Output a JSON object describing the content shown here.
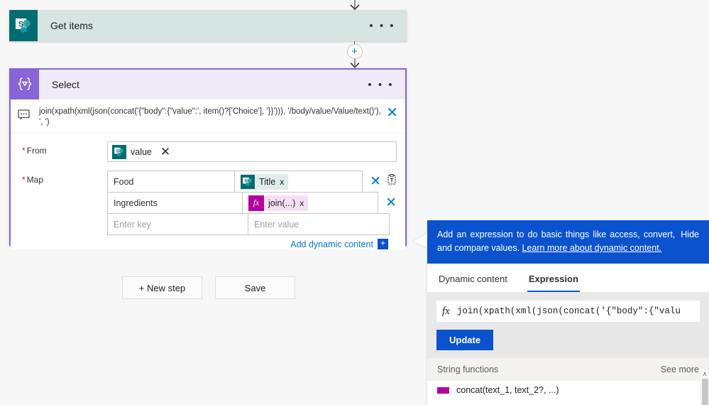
{
  "flow": {
    "get_items": {
      "title": "Get items",
      "icon": "sharepoint-icon",
      "menu": "• • •",
      "header_color": "#d6e4e2",
      "icon_color": "#036c70"
    },
    "add_step_plus": "+",
    "select": {
      "title": "Select",
      "icon": "select-braces-icon",
      "menu": "• • •",
      "header_color": "#eeeaf8",
      "icon_color": "#8764d8",
      "border_color": "#8764d8",
      "expression_summary": "join(xpath(xml(json(concat('{\"body\":{\"value\":', item()?['Choice'], '}}'))), '/body/value/Value/text()'), ', ')",
      "from": {
        "label": "From",
        "required": true,
        "token": {
          "label": "value",
          "icon": "sharepoint-icon"
        }
      },
      "map": {
        "label": "Map",
        "required": true,
        "rows": [
          {
            "key": "Food",
            "value": "Title",
            "value_kind": "sharepoint",
            "has_clipboard": true
          },
          {
            "key": "Ingredients",
            "value": "join(...)",
            "value_kind": "expression",
            "has_clipboard": false
          }
        ],
        "empty_row": {
          "key_placeholder": "Enter key",
          "value_placeholder": "Enter value"
        }
      },
      "add_dynamic_content": "Add dynamic content",
      "add_dynamic_plus": "+"
    }
  },
  "footer_buttons": [
    {
      "label": "+ New step",
      "name": "new-step-button"
    },
    {
      "label": "Save",
      "name": "save-button"
    }
  ],
  "expression_panel": {
    "banner": {
      "text_before_link": "Add an expression to do basic things like access, convert, and compare values. ",
      "link_text": "Learn more about dynamic content.",
      "hide_label": "Hide",
      "background": "#0b53ce"
    },
    "tabs": [
      {
        "label": "Dynamic content",
        "active": false
      },
      {
        "label": "Expression",
        "active": true
      }
    ],
    "editor": {
      "fx_glyph": "fx",
      "value": "join(xpath(xml(json(concat('{\"body\":{\"valu",
      "update_label": "Update"
    },
    "functions": {
      "section_title": "String functions",
      "see_more": "See more",
      "items": [
        {
          "label": "concat(text_1, text_2?, ...)"
        }
      ]
    },
    "scrollbar": {
      "up_arrow": "∧"
    }
  }
}
